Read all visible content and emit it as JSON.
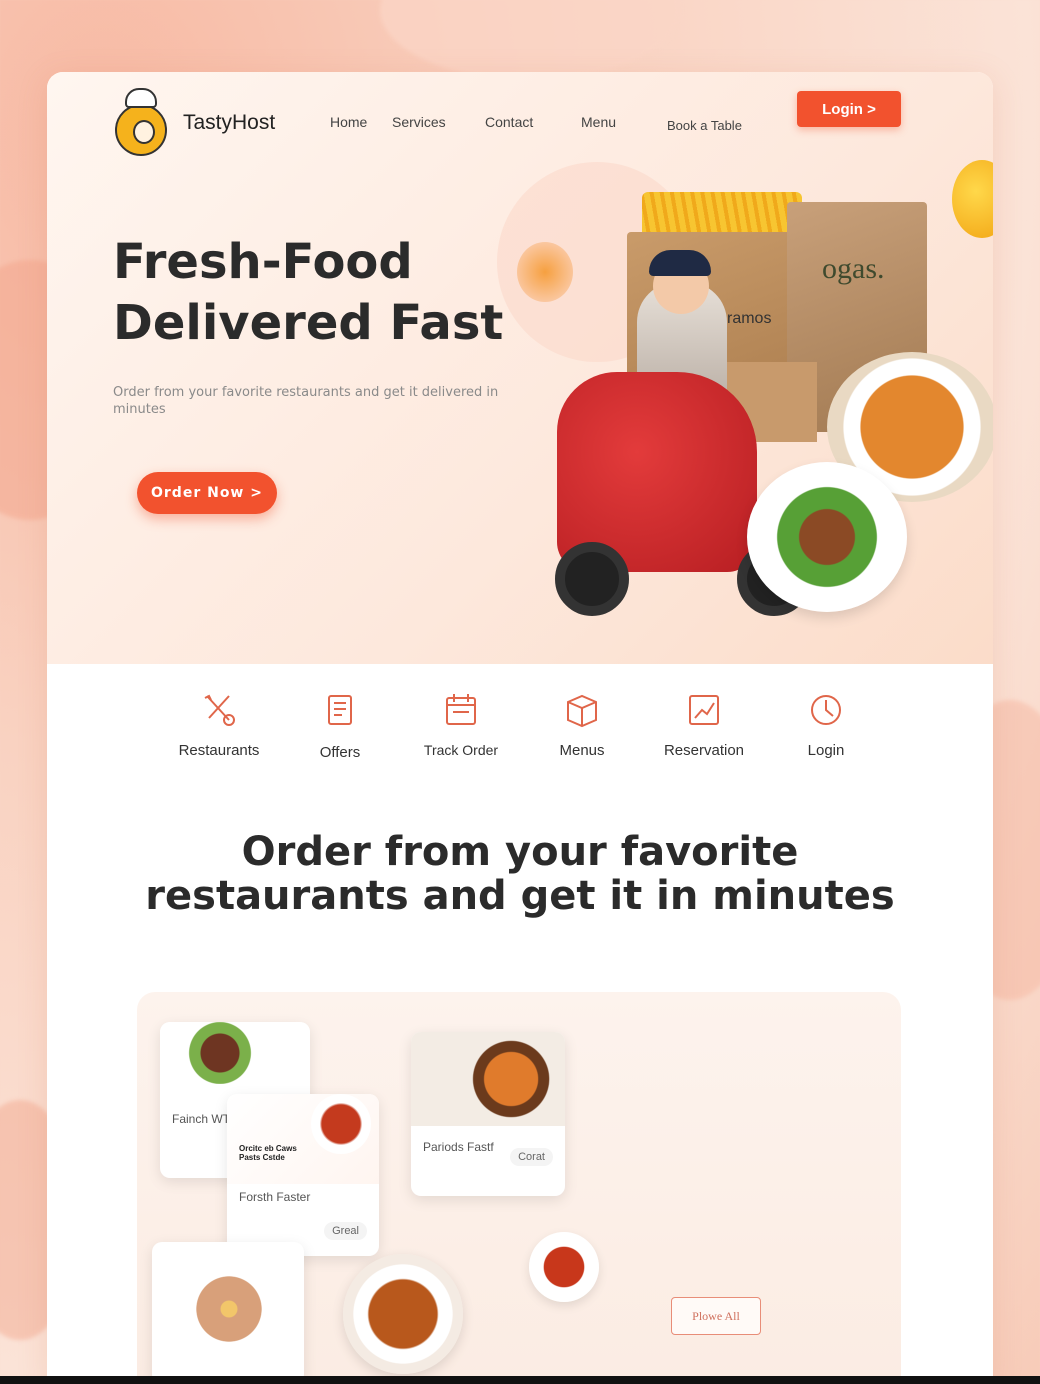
{
  "brand": {
    "name": "TastyHost"
  },
  "nav": {
    "items": [
      {
        "label": "Home"
      },
      {
        "label": "Services"
      },
      {
        "label": "Contact"
      },
      {
        "label": "Menu"
      },
      {
        "label": "Book a Table"
      }
    ],
    "login_label": "Login >"
  },
  "hero": {
    "title_line1": "Fresh-Food",
    "title_line2": "Delivered Fast",
    "subtitle": "Order from your favorite restaurants and get it delivered in minutes",
    "cta": "Order Now >",
    "bag_text": "ramos",
    "bag_logo": "ogas."
  },
  "categories": [
    {
      "label": "Restaurants",
      "icon": "utensils-icon"
    },
    {
      "label": "Offers",
      "icon": "document-icon"
    },
    {
      "label": "Track Order",
      "icon": "calendar-icon"
    },
    {
      "label": "Menus",
      "icon": "box-icon"
    },
    {
      "label": "Reservation",
      "icon": "chart-icon"
    },
    {
      "label": "Login",
      "icon": "clock-icon"
    }
  ],
  "section": {
    "title_line1": "Order from your favorite",
    "title_line2": "restaurants and get it in minutes"
  },
  "showcase": {
    "card1_title": "Fainch WTS",
    "card2_title": "Forsth Faster",
    "card2_caption": "Orcitc eb Caws Pasts Cstde",
    "card2_tag": "Greal",
    "card3_title": "Pariods Fastf",
    "card3_tag": "Corat",
    "view_all": "Plowe All"
  },
  "colors": {
    "accent": "#f2522e",
    "text_dark": "#2b2b2b",
    "bg_peach": "#fde8dc"
  }
}
